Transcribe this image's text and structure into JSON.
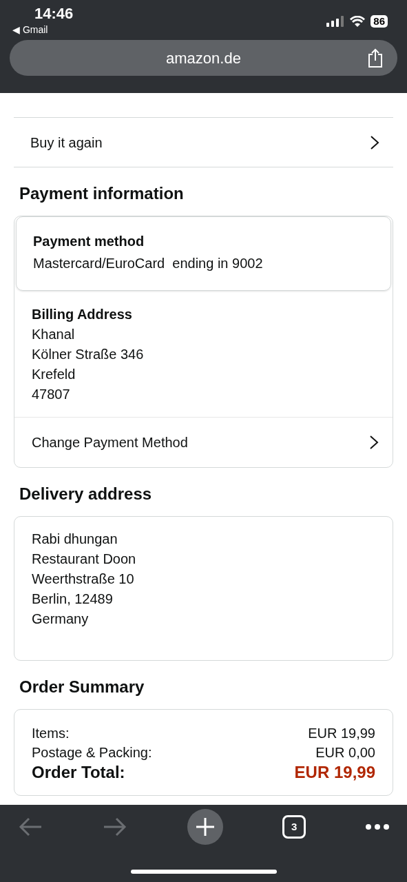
{
  "status_bar": {
    "time": "14:46",
    "back_app": "◀ Gmail",
    "battery": "86"
  },
  "address_bar": {
    "url": "amazon.de"
  },
  "menu_rows": [
    {
      "label": "Buy it again"
    }
  ],
  "payment": {
    "heading": "Payment information",
    "method_title": "Payment method",
    "method": "Mastercard/EuroCard  ending in 9002",
    "billing_title": "Billing Address",
    "billing_lines": [
      "Khanal",
      "Kölner Straße 346",
      "Krefeld",
      "47807"
    ],
    "change_label": "Change Payment Method"
  },
  "delivery": {
    "heading": "Delivery address",
    "lines": [
      "Rabi dhungan",
      "Restaurant Doon",
      "Weerthstraße 10",
      "Berlin, 12489",
      "Germany"
    ]
  },
  "summary": {
    "heading": "Order Summary",
    "rows": [
      {
        "label": "Items:",
        "value": "EUR 19,99",
        "kind": "line"
      },
      {
        "label": "Postage & Packing:",
        "value": "EUR 0,00",
        "kind": "line"
      },
      {
        "label": "Order Total:",
        "value": "EUR 19,99",
        "kind": "total"
      }
    ]
  },
  "toolbar": {
    "back_disabled": true,
    "forward_disabled": true,
    "tab_count": "3"
  }
}
